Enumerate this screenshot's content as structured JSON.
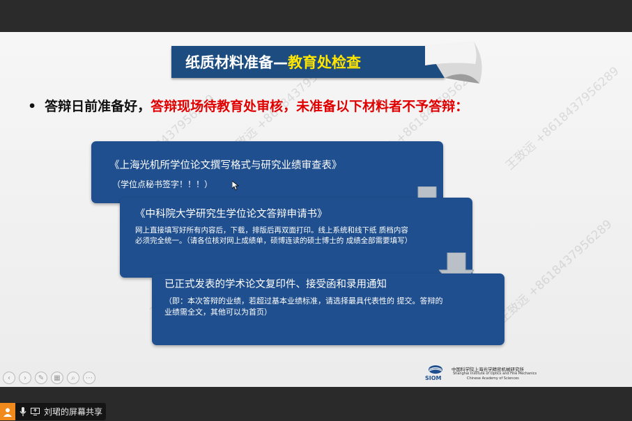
{
  "slide": {
    "title_white": "纸质材料准备—",
    "title_yellow": "教育处检查",
    "bullet_black": "答辩日前准备好，",
    "bullet_red": "答辩现场待教育处审核，未准备以下材料者不予答辩："
  },
  "boxes": [
    {
      "heading": "《上海光机所学位论文撰写格式与研究业绩审查表》",
      "sub": "（学位点秘书签字！！！）"
    },
    {
      "heading": "《中科院大学研究生学位论文答辩申请书》",
      "sub": "网上直接填写好所有内容后，下载，排版后再双面打印。线上系统和线下纸 质档内容必须完全统一。（请各位核对网上成绩单，硕博连读的硕士博士的 成绩全部需要填写）"
    },
    {
      "heading": "已正式发表的学术论文复印件、接受函和录用通知",
      "sub": "（即：本次答辩的业绩，若超过基本业绩标准，请选择最具代表性的 提交。答辩的业绩需全文，其他可以为首页）"
    }
  ],
  "watermark": "王致远 +8618437956289",
  "logo": {
    "abbr": "SIOM",
    "cn": "中国科学院上海光学精密机械研究所",
    "en1": "Shanghai Institute of Optics and Fine Mechanics",
    "en2": "Chinese Academy of Sciences"
  },
  "share": {
    "label": "刘珺的屏幕共享"
  },
  "colors": {
    "box_blue": "#1f4f8e",
    "title_blue": "#1d4c80",
    "highlight_red": "#e00000",
    "title_yellow": "#ffe600",
    "arrow_gray": "#b9c0c8"
  }
}
